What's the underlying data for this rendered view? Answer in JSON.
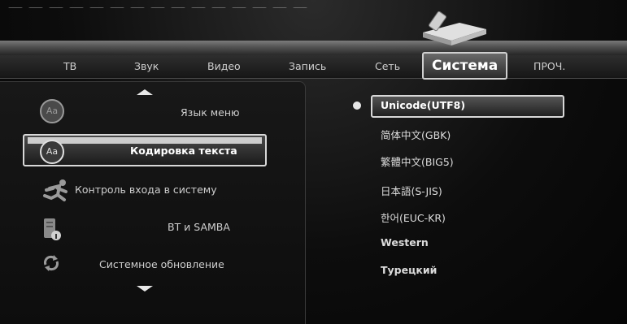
{
  "tabs": [
    {
      "label": "ТВ"
    },
    {
      "label": "Звук"
    },
    {
      "label": "Видео"
    },
    {
      "label": "Запись"
    },
    {
      "label": "Сеть"
    },
    {
      "label": "Система",
      "active": true
    },
    {
      "label": "ПРОЧ."
    }
  ],
  "menu": {
    "items": [
      {
        "label": "Язык меню",
        "icon": "aa-icon"
      },
      {
        "label": "Кодировка текста",
        "icon": "aa-icon",
        "selected": true
      },
      {
        "label": "Контроль входа в систему",
        "icon": "running-man-icon"
      },
      {
        "label": "BT и SAMBA",
        "icon": "device-icon"
      },
      {
        "label": "Системное обновление",
        "icon": "refresh-icon"
      }
    ]
  },
  "options": {
    "items": [
      {
        "label": "Unicode(UTF8)",
        "selected": true
      },
      {
        "label": "简体中文(GBK)"
      },
      {
        "label": "繁體中文(BIG5)"
      },
      {
        "label": "日本語(S-JIS)"
      },
      {
        "label": "한어(EUC-KR)"
      },
      {
        "label": "Western"
      },
      {
        "label": "Турецкий"
      }
    ]
  },
  "icons": {
    "aa_text": "Aa"
  },
  "colors": {
    "highlight_border": "#d8d8d8",
    "background": "#0a0a0a"
  }
}
